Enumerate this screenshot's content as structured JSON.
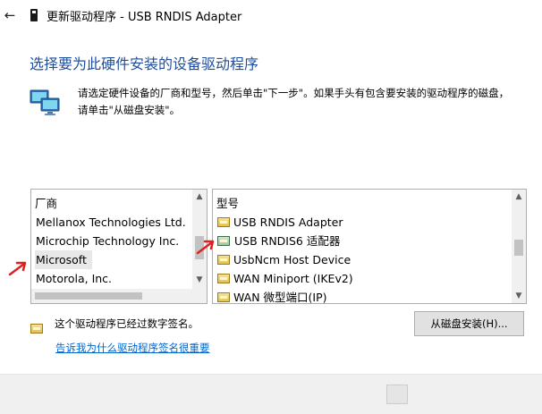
{
  "window": {
    "title": "更新驱动程序 - USB RNDIS Adapter",
    "back_icon": "back-arrow-icon",
    "title_icon": "usb-device-icon"
  },
  "heading": "选择要为此硬件安装的设备驱动程序",
  "instruction": {
    "icon": "network-computers-icon",
    "line1": "请选定硬件设备的厂商和型号，然后单击\"下一步\"。如果手头有包含要安装的驱动程序的磁盘，",
    "line2": "请单击\"从磁盘安装\"。"
  },
  "manufacturer_list": {
    "header": "厂商",
    "items": [
      "Mellanox Technologies Ltd.",
      "Microchip Technology Inc.",
      "Microsoft",
      "Motorola, Inc."
    ],
    "selected": "Microsoft"
  },
  "model_list": {
    "header": "型号",
    "items": [
      "USB RNDIS Adapter",
      "USB RNDIS6 适配器",
      "UsbNcm Host Device",
      "WAN Miniport (IKEv2)",
      "WAN 微型端口(IP)"
    ],
    "selected": "USB RNDIS6 适配器"
  },
  "signature": {
    "icon": "driver-signed-icon",
    "text": "这个驱动程序已经过数字签名。",
    "link": "告诉我为什么驱动程序签名很重要"
  },
  "have_disk_button": "从磁盘安装(H)...",
  "colors": {
    "heading": "#1f4e9e",
    "selection_blue": "#0078d7",
    "link": "#0066cc",
    "annotation_arrow": "#e02020"
  }
}
